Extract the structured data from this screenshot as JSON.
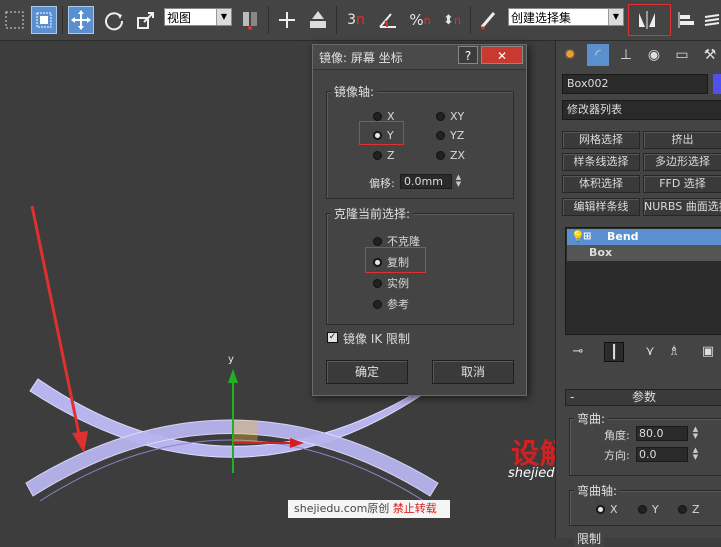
{
  "toolbar": {
    "view_select": "视图",
    "named_selection_select": "创建选择集",
    "snap_3": "3",
    "snap_n": "n"
  },
  "viewport": {
    "axis_y_label": "y",
    "watermark_site": "shejiedu.com原创",
    "watermark_warning": "禁止转载",
    "logo_text": "设解读",
    "logo_url": "shejiedu.com",
    "colors": {
      "object_fill": "#b8b4ee",
      "object_edge": "#e0dcff",
      "arrow": "#e03030",
      "gizmo_y": "#22b022",
      "gizmo_x": "#d02020",
      "gizmo_box": "#f0c030"
    }
  },
  "dialog": {
    "title": "镜像: 屏幕 坐标",
    "help_btn": "?",
    "close_btn": "✕",
    "mirror_axis": {
      "label": "镜像轴:",
      "options": [
        "X",
        "Y",
        "Z",
        "XY",
        "YZ",
        "ZX"
      ],
      "selected": "Y",
      "offset_label": "偏移:",
      "offset_value": "0.0mm"
    },
    "clone": {
      "label": "克隆当前选择:",
      "options": [
        "不克隆",
        "复制",
        "实例",
        "参考"
      ],
      "selected": "复制"
    },
    "mirror_ik_label": "镜像 IK 限制",
    "mirror_ik_checked": true,
    "ok_label": "确定",
    "cancel_label": "取消"
  },
  "panel": {
    "object_name": "Box002",
    "modifier_list": "修改器列表",
    "modifier_buttons": [
      "网格选择",
      "挤出",
      "样条线选择",
      "多边形选择",
      "体积选择",
      "FFD 选择",
      "编辑样条线",
      "NURBS 曲面选择"
    ],
    "stack": [
      {
        "label": "Bend",
        "selected": true
      },
      {
        "label": "Box",
        "selected": false
      }
    ],
    "params_title": "参数",
    "bend_label": "弯曲:",
    "angle_label": "角度:",
    "angle_value": "80.0",
    "direction_label": "方向:",
    "direction_value": "0.0",
    "bend_axis_label": "弯曲轴:",
    "bend_axis_options": [
      "X",
      "Y",
      "Z"
    ],
    "bend_axis_selected": "X",
    "limit_label": "限制"
  }
}
